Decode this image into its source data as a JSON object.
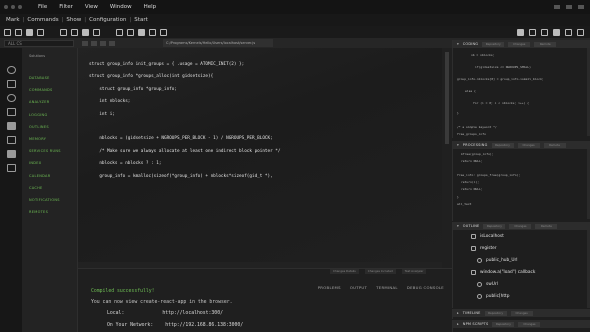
{
  "menubar": {
    "items": [
      "File",
      "Filter",
      "View",
      "Window",
      "Help"
    ]
  },
  "menu2": {
    "items": [
      "Mark",
      "Commands",
      "Show",
      "Configuration",
      "Start"
    ]
  },
  "tabrow": {
    "search_placeholder": "ALL   CS",
    "file_tab": "C:/Programs/Kernels/Hello/Users/localhost/server.js"
  },
  "sidebar": {
    "header": "Solutions",
    "items": [
      "DATABASE",
      "COMMANDS",
      "ANALYZER",
      "LOGGING",
      "OUTLINES",
      "MEMORY",
      "SERVICES RUNS",
      "INDEX",
      "CALENDAR",
      "CACHE",
      "NOTIFICATIONS",
      "REMOTES"
    ]
  },
  "editor": {
    "lines": [
      "struct group_info init_groups = { .usage = ATOMIC_INIT(2) };",
      "struct group_info *groups_alloc(int gidsetsize){",
      "    struct group_info *group_info;",
      "    int nblocks;",
      "    int i;",
      "",
      "    nblocks = (gidsetsize + NGROUPS_PER_BLOCK - 1) / NGROUPS_PER_BLOCK;",
      "    /* Make sure we always allocate at least one indirect block pointer */",
      "    nblocks = nblocks ? : 1;",
      "    group_info = kmalloc(sizeof(*group_info) + nblocks*sizeof(gid_t *),"
    ]
  },
  "panels": {
    "coding": {
      "title": "CODING",
      "chips": [
        "Repository",
        "Changes",
        "Remote"
      ],
      "lines": [
        "nb = nblocks;",
        "if(gidsetsize <= NGROUPS_SMALL)",
        "  group_info->blocks[0] = group_info->small_block;",
        "else {",
        "  for (i = 0; i < nblocks; i++) {",
        "}",
        "",
        "/* a simple keyword */",
        "free_groups_info"
      ]
    },
    "processing": {
      "title": "PROCESSING",
      "chips": [
        "Repository",
        "Changes",
        "Remote"
      ],
      "lines": [
        "kfree(group_info);",
        "return NULL;",
        "",
        "free_info: groups_free(group_info);",
        "  return(i);",
        "  return NULL;",
        "}",
        "all_text"
      ]
    },
    "outline": {
      "title": "OUTLINE",
      "chips": [
        "Repository",
        "Changes",
        "Remote"
      ],
      "items": [
        "isLocalhost",
        "register",
        "public_hub_Url",
        "window.a(\"load\") callback",
        "swUrl",
        "public[http"
      ]
    },
    "timeline": {
      "title": "TIMELINE",
      "chips": [
        "Repository",
        "Changes"
      ]
    },
    "npm": {
      "title": "NPM SCRIPTS",
      "chips": [
        "Repository",
        "Changes"
      ]
    }
  },
  "bottom": {
    "subtabs": [
      "Changes Details",
      "Changes Included",
      "Test Analyzer"
    ],
    "tabs": [
      "PROBLEMS",
      "OUTPUT",
      "TERMINAL",
      "DEBUG CONSOLE"
    ],
    "terminal": {
      "line1": "Compiled successfully!",
      "line2": "You can now view create-react-app in the browser.",
      "local_label": "Local:",
      "local_value": "http://localhost:300/",
      "network_label": "On Your Network:",
      "network_value": "http://192.168.86.138:3000/"
    }
  }
}
